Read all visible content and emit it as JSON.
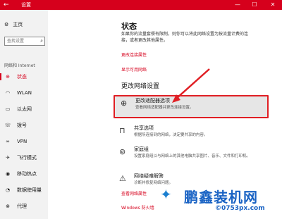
{
  "window": {
    "title": "设置",
    "back_icon": "back-arrow-icon",
    "min": "—",
    "max": "☐",
    "close": "✕",
    "accent": "#d6001c"
  },
  "sidebar": {
    "home": "主页",
    "search_placeholder": "查找设置",
    "section": "网络和 Internet",
    "items": [
      {
        "label": "状态",
        "icon": "status-icon",
        "glyph": "⊕",
        "active": true
      },
      {
        "label": "WLAN",
        "icon": "wifi-icon",
        "glyph": "◠"
      },
      {
        "label": "以太网",
        "icon": "ethernet-icon",
        "glyph": "▭"
      },
      {
        "label": "拨号",
        "icon": "dialup-icon",
        "glyph": "☏"
      },
      {
        "label": "VPN",
        "icon": "vpn-icon",
        "glyph": "∞"
      },
      {
        "label": "飞行模式",
        "icon": "airplane-icon",
        "glyph": "✈"
      },
      {
        "label": "移动热点",
        "icon": "hotspot-icon",
        "glyph": "◉"
      },
      {
        "label": "数据使用量",
        "icon": "data-usage-icon",
        "glyph": "◔"
      },
      {
        "label": "代理",
        "icon": "proxy-icon",
        "glyph": "⊗"
      }
    ]
  },
  "main": {
    "title": "状态",
    "description": "如果你的流量套餐有限制，则你可以将此网络设置为按流量计费的连接，或者更改其他属性。",
    "links": {
      "change_properties": "更改连接属性",
      "show_networks": "显示可用网络"
    },
    "change_heading": "更改网络设置",
    "options": [
      {
        "title": "更改适配器选项",
        "desc": "查看网络适配器并更改连接设置。",
        "icon": "adapter-icon",
        "glyph": "⊕"
      },
      {
        "title": "共享选项",
        "desc": "根据所连接到的网络，决定要共享的内容。",
        "icon": "sharing-icon",
        "glyph": "⊓"
      },
      {
        "title": "家庭组",
        "desc": "设置家庭组以与网络上的其他电脑共享图片、音乐、文件和打印机。",
        "icon": "homegroup-icon",
        "glyph": "⊚"
      },
      {
        "title": "网络疑难解答",
        "desc": "诊断并修复网络问题。",
        "icon": "warning-icon",
        "glyph": "⚠"
      }
    ],
    "bottom_links": {
      "hardware": "查看网络属性",
      "firewall": "Windows 防火墙"
    }
  },
  "watermark": {
    "brand": "鹏鑫装机网",
    "url": "©0753px.com"
  }
}
